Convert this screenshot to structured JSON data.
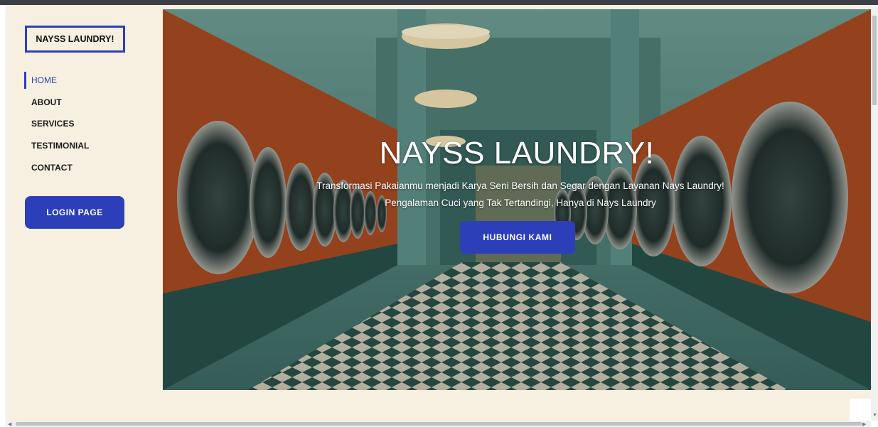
{
  "sidebar": {
    "brand": "NAYSS LAUNDRY!",
    "nav": [
      {
        "label": "HOME",
        "active": true
      },
      {
        "label": "ABOUT",
        "active": false
      },
      {
        "label": "SERVICES",
        "active": false
      },
      {
        "label": "TESTIMONIAL",
        "active": false
      },
      {
        "label": "CONTACT",
        "active": false
      }
    ],
    "login_label": "LOGIN PAGE"
  },
  "hero": {
    "title": "NAYSS LAUNDRY!",
    "subtitle": "Transformasi Pakaianmu menjadi Karya Seni Bersih dan Segar dengan Layanan Nays Laundry! Pengalaman Cuci yang Tak Tertandingi, Hanya di Nays Laundry",
    "cta_label": "HUBUNGI KAMI",
    "image_icon": "laundromat-photo"
  },
  "colors": {
    "accent": "#2c3fb8",
    "sidebar_bg": "#f7efe0",
    "machine_orange": "#b8542a",
    "machine_teal": "#2e5450"
  }
}
